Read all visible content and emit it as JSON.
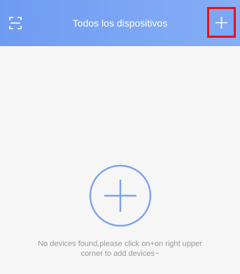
{
  "header": {
    "title": "Todos los dispositivos",
    "left_icon": "scan-icon",
    "right_icon": "plus-icon"
  },
  "empty_state": {
    "icon": "plus-circle-icon",
    "message_line1": "No devices found,please click on+on right upper",
    "message_line2": "corner to add devices~"
  },
  "colors": {
    "header_start": "#6f9bf2",
    "header_end": "#86aef6",
    "background": "#f6f6f6",
    "highlight": "#e0141c",
    "message_text": "#9a9a9a"
  }
}
